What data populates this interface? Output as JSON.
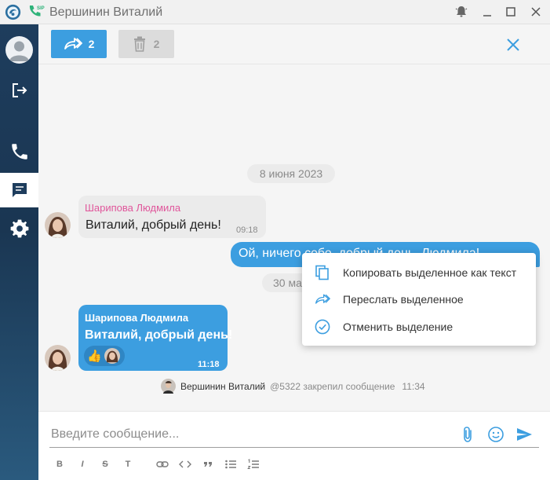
{
  "window": {
    "title": "Вершинин Виталий"
  },
  "selection_bar": {
    "forward_count": "2",
    "delete_count": "2"
  },
  "chat": {
    "date_1": "8 июня 2023",
    "message_1": {
      "sender": "Шарипова Людмила",
      "text": "Виталий, добрый день!",
      "time": "09:18"
    },
    "message_2": {
      "text": "Ой, ничего себе, добрый день, Людмила!"
    },
    "date_2": "30 ма",
    "message_3": {
      "sender": "Шарипова Людмила",
      "text": "Виталий, добрый день!",
      "time": "11:18",
      "reaction": "👍"
    },
    "pinned": {
      "author": "Вершинин Виталий",
      "text": "@5322 закрепил сообщение",
      "time": "11:34"
    }
  },
  "context_menu": {
    "items": [
      {
        "label": "Копировать выделенное как текст",
        "icon": "copy-icon"
      },
      {
        "label": "Переслать выделенное",
        "icon": "forward-icon"
      },
      {
        "label": "Отменить выделение",
        "icon": "check-circle-icon"
      }
    ]
  },
  "composer": {
    "placeholder": "Введите сообщение...",
    "format_buttons": [
      "B",
      "I",
      "S",
      "T"
    ]
  },
  "colors": {
    "accent": "#3c9ee0",
    "sender_pink": "#e0569b",
    "sidebar": "#1e3d5d"
  }
}
